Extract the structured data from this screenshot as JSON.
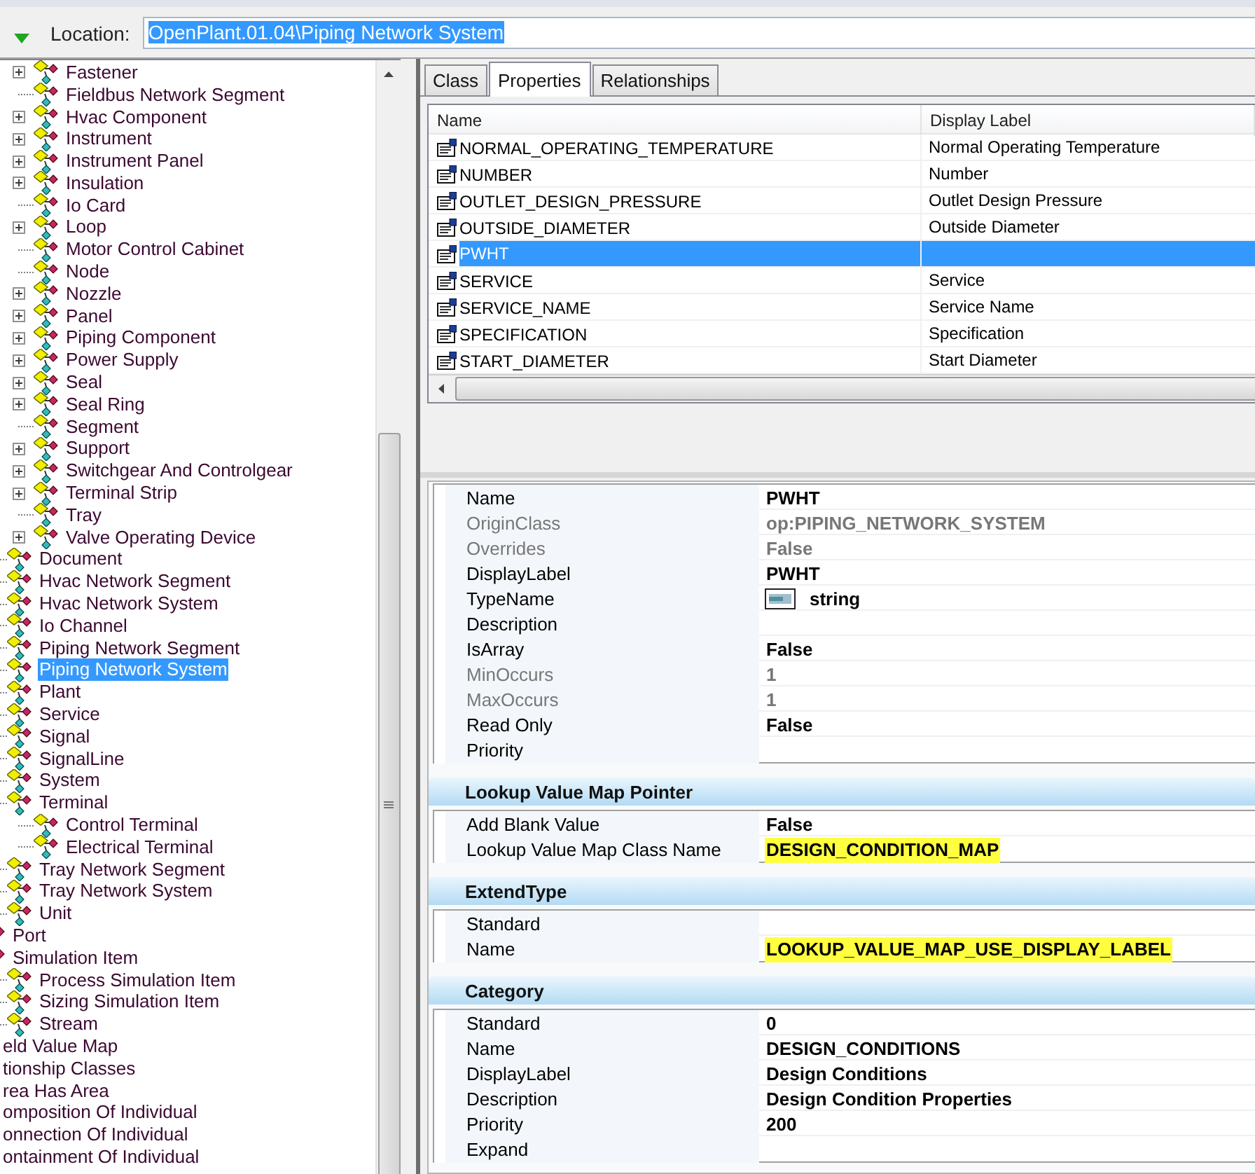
{
  "location": {
    "label": "Location:",
    "value": "OpenPlant.01.04\\Piping Network System",
    "text_selected": true
  },
  "tree": {
    "items": [
      {
        "children": [
          {
            "children": [
              {
                "children": [
                  {
                    "children": [
                      {
                        "label": "Fastener",
                        "collapsed": true,
                        "selected": false
                      },
                      {
                        "label": "Fieldbus Network Segment",
                        "collapsed": false,
                        "selected": false
                      },
                      {
                        "label": "Hvac Component",
                        "collapsed": true,
                        "selected": false
                      },
                      {
                        "label": "Instrument",
                        "collapsed": true,
                        "selected": false
                      },
                      {
                        "label": "Instrument Panel",
                        "collapsed": true,
                        "selected": false
                      },
                      {
                        "label": "Insulation",
                        "collapsed": true,
                        "selected": false
                      },
                      {
                        "label": "Io Card",
                        "collapsed": false,
                        "selected": false
                      },
                      {
                        "label": "Loop",
                        "collapsed": true,
                        "selected": false
                      },
                      {
                        "label": "Motor Control Cabinet",
                        "collapsed": false,
                        "selected": false
                      },
                      {
                        "label": "Node",
                        "collapsed": false,
                        "selected": false
                      },
                      {
                        "label": "Nozzle",
                        "collapsed": true,
                        "selected": false
                      },
                      {
                        "label": "Panel",
                        "collapsed": true,
                        "selected": false
                      },
                      {
                        "label": "Piping Component",
                        "collapsed": true,
                        "selected": false
                      },
                      {
                        "label": "Power Supply",
                        "collapsed": true,
                        "selected": false
                      },
                      {
                        "label": "Seal",
                        "collapsed": true,
                        "selected": false
                      },
                      {
                        "label": "Seal Ring",
                        "collapsed": true,
                        "selected": false
                      },
                      {
                        "label": "Segment",
                        "collapsed": false,
                        "selected": false
                      },
                      {
                        "label": "Support",
                        "collapsed": true,
                        "selected": false
                      },
                      {
                        "label": "Switchgear And Controlgear",
                        "collapsed": true,
                        "selected": false
                      },
                      {
                        "label": "Terminal Strip",
                        "collapsed": true,
                        "selected": false
                      },
                      {
                        "label": "Tray",
                        "collapsed": false,
                        "selected": false
                      },
                      {
                        "label": "Valve Operating Device",
                        "collapsed": true,
                        "selected": false
                      }
                    ]
                  },
                  {
                    "label": "Document",
                    "selected": false
                  },
                  {
                    "label": "Hvac Network Segment",
                    "selected": false
                  },
                  {
                    "label": "Hvac Network System",
                    "selected": false
                  },
                  {
                    "label": "Io Channel",
                    "selected": false
                  },
                  {
                    "label": "Piping Network Segment",
                    "selected": false
                  },
                  {
                    "label": "Piping Network System",
                    "selected": true
                  },
                  {
                    "label": "Plant",
                    "selected": false
                  },
                  {
                    "label": "Service",
                    "selected": false
                  },
                  {
                    "label": "Signal",
                    "selected": false
                  },
                  {
                    "label": "SignalLine",
                    "selected": false
                  },
                  {
                    "label": "System",
                    "selected": false
                  },
                  {
                    "label": "Terminal",
                    "selected": false,
                    "children": [
                      {
                        "label": "Control Terminal",
                        "collapsed": false,
                        "selected": false
                      },
                      {
                        "label": "Electrical Terminal",
                        "collapsed": false,
                        "selected": false
                      }
                    ]
                  },
                  {
                    "label": "Tray Network Segment",
                    "selected": false
                  },
                  {
                    "label": "Tray Network System",
                    "selected": false
                  },
                  {
                    "label": "Unit",
                    "selected": false
                  }
                ]
              },
              {
                "label": "Port",
                "selected": false
              },
              {
                "label": "Simulation Item",
                "selected": false,
                "children": [
                  {
                    "label": "Process Simulation Item",
                    "selected": false
                  },
                  {
                    "label": "Sizing Simulation Item",
                    "selected": false
                  },
                  {
                    "label": "Stream",
                    "selected": false
                  }
                ]
              }
            ]
          },
          {
            "label": "eld Value Map",
            "selected": false
          }
        ]
      },
      {
        "label": "tionship Classes",
        "selected": false,
        "children": [
          {
            "label": "rea Has Area",
            "selected": false
          },
          {
            "label": "omposition Of Individual",
            "selected": false
          },
          {
            "label": "onnection Of Individual",
            "selected": false
          },
          {
            "label": "ontainment Of Individual",
            "selected": false
          }
        ]
      }
    ]
  },
  "tabs": [
    {
      "label": "Class",
      "selected": false
    },
    {
      "label": "Properties",
      "selected": true
    },
    {
      "label": "Relationships",
      "selected": false
    }
  ],
  "property_list": {
    "columns": [
      "Name",
      "Display Label"
    ],
    "rows": [
      {
        "name": "NORMAL_OPERATING_TEMPERATURE",
        "display_label": "Normal Operating Temperature",
        "selected": false
      },
      {
        "name": "NUMBER",
        "display_label": "Number",
        "selected": false
      },
      {
        "name": "OUTLET_DESIGN_PRESSURE",
        "display_label": "Outlet Design Pressure",
        "selected": false
      },
      {
        "name": "OUTSIDE_DIAMETER",
        "display_label": "Outside Diameter",
        "selected": false
      },
      {
        "name": "PWHT",
        "selected": true
      },
      {
        "name": "SERVICE",
        "display_label": "Service",
        "selected": false
      },
      {
        "name": "SERVICE_NAME",
        "display_label": "Service Name",
        "selected": false
      },
      {
        "name": "SPECIFICATION",
        "display_label": "Specification",
        "selected": false
      },
      {
        "name": "START_DIAMETER",
        "display_label": "Start Diameter",
        "selected": false
      }
    ]
  },
  "property_grid": {
    "sections": [
      {
        "rows": [
          {
            "label": "Name",
            "value": "PWHT",
            "kind": "text",
            "disabled": false,
            "highlighted": false
          },
          {
            "label": "OriginClass",
            "value": "op:PIPING_NETWORK_SYSTEM",
            "kind": "text",
            "disabled": true,
            "highlighted": false
          },
          {
            "label": "Overrides",
            "value": "False",
            "kind": "text",
            "disabled": true,
            "highlighted": false
          },
          {
            "label": "DisplayLabel",
            "value": "PWHT",
            "kind": "text",
            "disabled": false,
            "highlighted": false
          },
          {
            "label": "TypeName",
            "value": "string",
            "kind": "type",
            "disabled": false,
            "highlighted": false
          },
          {
            "label": "Description",
            "kind": "text",
            "disabled": false,
            "highlighted": false
          },
          {
            "label": "IsArray",
            "value": "False",
            "kind": "text",
            "disabled": false,
            "highlighted": false
          },
          {
            "label": "MinOccurs",
            "value": "1",
            "kind": "text",
            "disabled": true,
            "highlighted": false
          },
          {
            "label": "MaxOccurs",
            "value": "1",
            "kind": "text",
            "disabled": true,
            "highlighted": false
          },
          {
            "label": "Read Only",
            "value": "False",
            "kind": "text",
            "disabled": false,
            "highlighted": false
          },
          {
            "label": "Priority",
            "kind": "text",
            "disabled": false,
            "highlighted": false
          }
        ]
      },
      {
        "title": "Lookup Value Map Pointer",
        "rows": [
          {
            "label": "Add Blank Value",
            "value": "False",
            "kind": "text",
            "disabled": false,
            "highlighted": false
          },
          {
            "label": "Lookup Value Map Class Name",
            "value": "DESIGN_CONDITION_MAP",
            "kind": "text",
            "disabled": false,
            "highlighted": true
          }
        ]
      },
      {
        "title": "ExtendType",
        "rows": [
          {
            "label": "Standard",
            "kind": "text",
            "disabled": false,
            "highlighted": false
          },
          {
            "label": "Name",
            "value": "LOOKUP_VALUE_MAP_USE_DISPLAY_LABEL",
            "kind": "text",
            "disabled": false,
            "highlighted": true
          }
        ]
      },
      {
        "title": "Category",
        "rows": [
          {
            "label": "Standard",
            "value": "0",
            "kind": "text",
            "disabled": false,
            "highlighted": false
          },
          {
            "label": "Name",
            "value": "DESIGN_CONDITIONS",
            "kind": "text",
            "disabled": false,
            "highlighted": false
          },
          {
            "label": "DisplayLabel",
            "value": "Design Conditions",
            "kind": "text",
            "disabled": false,
            "highlighted": false
          },
          {
            "label": "Description",
            "value": "Design Condition Properties",
            "kind": "text",
            "disabled": false,
            "highlighted": false
          },
          {
            "label": "Priority",
            "value": "200",
            "kind": "text",
            "disabled": false,
            "highlighted": false
          },
          {
            "label": "Expand",
            "kind": "text",
            "disabled": false,
            "highlighted": false
          }
        ]
      }
    ]
  }
}
